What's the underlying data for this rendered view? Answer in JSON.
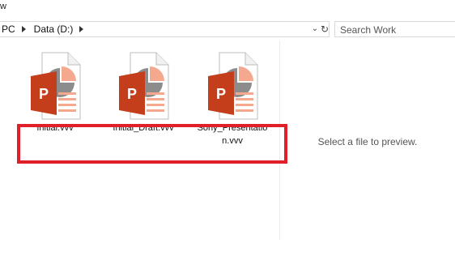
{
  "window": {
    "title_fragment": "w"
  },
  "address": {
    "crumbs": [
      "PC",
      "Data (D:)"
    ]
  },
  "search": {
    "placeholder": "Search Work"
  },
  "files": [
    {
      "name": "Initial.vvv",
      "icon": "powerpoint-file-icon"
    },
    {
      "name": "Initial_Draft.vvv",
      "icon": "powerpoint-file-icon"
    },
    {
      "name": "Sony_Presentation.vvv",
      "icon": "powerpoint-file-icon"
    }
  ],
  "preview": {
    "message": "Select a file to preview."
  },
  "colors": {
    "highlight": "#e01f2b",
    "ppt_orange": "#c43e1c",
    "border": "#d9d9d9"
  }
}
